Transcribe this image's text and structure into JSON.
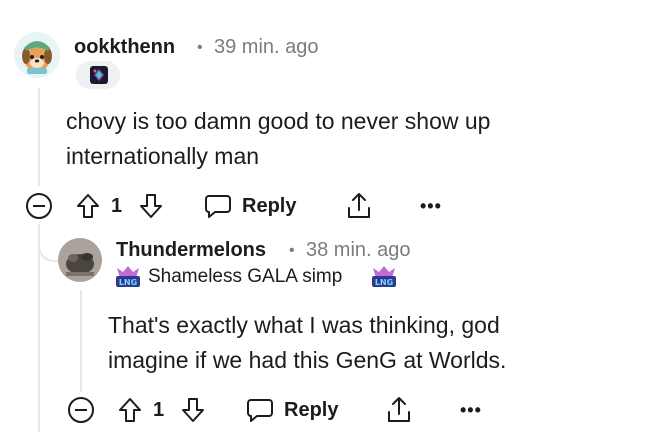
{
  "comments": [
    {
      "username": "ookkthenn",
      "separator": "•",
      "time": "39 min. ago",
      "body_lines": [
        "chovy is too damn good to never show up",
        "internationally man"
      ],
      "vote_count": "1",
      "reply_label": "Reply",
      "more_label": "•••"
    },
    {
      "username": "Thundermelons",
      "separator": "•",
      "time": "38 min. ago",
      "flair": "Shameless GALA simp",
      "flair_badge": "LNG",
      "body_lines": [
        "That's exactly what I was thinking, god",
        "imagine if we had this GenG at Worlds."
      ],
      "vote_count": "1",
      "reply_label": "Reply",
      "more_label": "•••"
    }
  ],
  "icons": {
    "collapse": "collapse-minus-icon",
    "upvote": "upvote-arrow-icon",
    "downvote": "downvote-arrow-icon",
    "reply": "speech-bubble-icon",
    "share": "share-icon",
    "more": "more-options-icon"
  },
  "colors": {
    "text": "#1c1c1c",
    "meta": "#7c7c7c",
    "thread_line": "#e5e7e9",
    "avatar1_bg": "#7ec4cf",
    "flair_badge": "#2b3a8f"
  }
}
